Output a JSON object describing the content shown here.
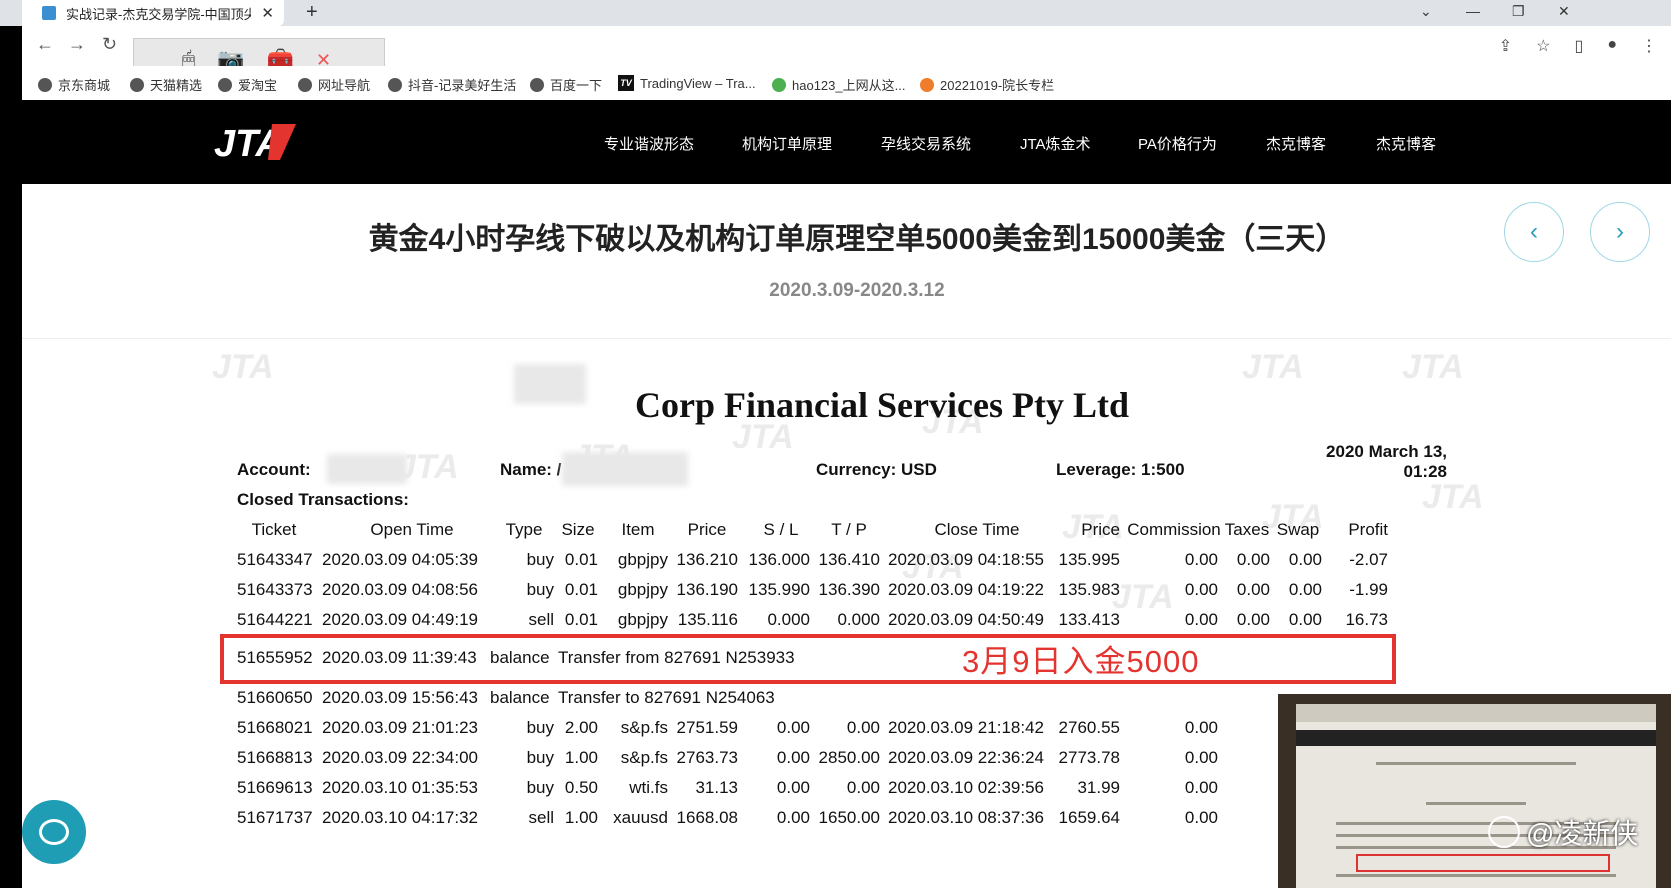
{
  "browser": {
    "tab_title": "实战记录-杰克交易学院-中国顶尖",
    "tab_close": "✕",
    "new_tab": "+",
    "bookmarks": [
      "京东商城",
      "天猫精选",
      "爱淘宝",
      "网址导航",
      "抖音-记录美好生活",
      "百度一下",
      "TradingView – Tra...",
      "hao123_上网从这...",
      "20221019-院长专栏"
    ]
  },
  "nav": {
    "logo_text": "JTA",
    "links": [
      "专业谐波形态",
      "机构订单原理",
      "孕线交易系统",
      "JTA炼金术",
      "PA价格行为",
      "杰克博客",
      "杰克博客"
    ]
  },
  "page": {
    "title": "黄金4小时孕线下破以及机构订单原理空单5000美金到15000美金（三天）",
    "date_range": "2020.3.09-2020.3.12",
    "prev_arrow": "‹",
    "next_arrow": "›"
  },
  "statement": {
    "company": "Corp Financial Services Pty Ltd",
    "account_label": "Account:",
    "name_label": "Name: /",
    "currency": "Currency: USD",
    "leverage": "Leverage: 1:500",
    "date_line1": "2020 March 13,",
    "date_line2": "01:28",
    "section": "Closed Transactions:",
    "headers": [
      "Ticket",
      "Open Time",
      "Type",
      "Size",
      "Item",
      "Price",
      "S / L",
      "T / P",
      "Close Time",
      "Price",
      "Commission",
      "Taxes",
      "Swap",
      "Profit"
    ],
    "rows": [
      [
        "51643347",
        "2020.03.09 04:05:39",
        "buy",
        "0.01",
        "gbpjpy",
        "136.210",
        "136.000",
        "136.410",
        "2020.03.09 04:18:55",
        "135.995",
        "0.00",
        "0.00",
        "0.00",
        "-2.07"
      ],
      [
        "51643373",
        "2020.03.09 04:08:56",
        "buy",
        "0.01",
        "gbpjpy",
        "136.190",
        "135.990",
        "136.390",
        "2020.03.09 04:19:22",
        "135.983",
        "0.00",
        "0.00",
        "0.00",
        "-1.99"
      ],
      [
        "51644221",
        "2020.03.09 04:49:19",
        "sell",
        "0.01",
        "gbpjpy",
        "135.116",
        "0.000",
        "0.000",
        "2020.03.09 04:50:49",
        "133.413",
        "0.00",
        "0.00",
        "0.00",
        "16.73"
      ]
    ],
    "balance_rows": [
      [
        "51655952",
        "2020.03.09 11:39:43",
        "balance",
        "Transfer from 827691 N253933"
      ],
      [
        "51660650",
        "2020.03.09 15:56:43",
        "balance",
        "Transfer to 827691 N254063"
      ]
    ],
    "rows2": [
      [
        "51668021",
        "2020.03.09 21:01:23",
        "buy",
        "2.00",
        "s&p.fs",
        "2751.59",
        "0.00",
        "0.00",
        "2020.03.09 21:18:42",
        "2760.55",
        "0.00"
      ],
      [
        "51668813",
        "2020.03.09 22:34:00",
        "buy",
        "1.00",
        "s&p.fs",
        "2763.73",
        "0.00",
        "2850.00",
        "2020.03.09 22:36:24",
        "2773.78",
        "0.00"
      ],
      [
        "51669613",
        "2020.03.10 01:35:53",
        "buy",
        "0.50",
        "wti.fs",
        "31.13",
        "0.00",
        "0.00",
        "2020.03.10 02:39:56",
        "31.99",
        "0.00"
      ],
      [
        "51671737",
        "2020.03.10 04:17:32",
        "sell",
        "1.00",
        "xauusd",
        "1668.08",
        "0.00",
        "1650.00",
        "2020.03.10 08:37:36",
        "1659.64",
        "0.00"
      ]
    ],
    "annotation": "3月9日入金5000"
  },
  "overlay": {
    "weibo_handle": "@凌新侠"
  },
  "colors": {
    "accent": "#2a9dbc",
    "annotation": "#e3342f"
  }
}
